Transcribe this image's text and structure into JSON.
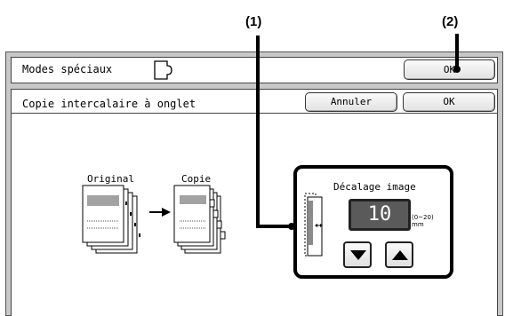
{
  "callouts": {
    "one": "(1)",
    "two": "(2)"
  },
  "header": {
    "title": "Modes spéciaux",
    "ok_label": "OK"
  },
  "panel": {
    "title": "Copie intercalaire à onglet",
    "cancel_label": "Annuler",
    "ok_label": "OK",
    "original_caption": "Original",
    "copy_caption": "Copie"
  },
  "shift": {
    "label": "Décalage image",
    "value": "10",
    "range": "(0~20)",
    "unit": "mm"
  },
  "icons": [
    "original-stack-icon",
    "arrow-right-icon",
    "copy-stack-icon",
    "image-shift-icon",
    "arrow-down-icon",
    "arrow-up-icon"
  ]
}
